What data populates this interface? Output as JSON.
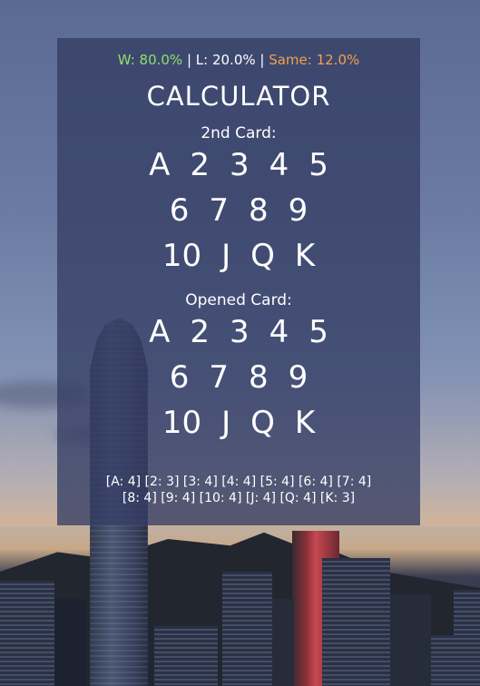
{
  "stats": {
    "win": "W: 80.0%",
    "sep1": " | ",
    "lose": "L: 20.0%",
    "sep2": " | ",
    "same": "Same: 12.0%"
  },
  "title": "CALCULATOR",
  "second_card": {
    "label": "2nd Card:",
    "rows": [
      [
        "A",
        "2",
        "3",
        "4",
        "5"
      ],
      [
        "6",
        "7",
        "8",
        "9"
      ],
      [
        "10",
        "J",
        "Q",
        "K"
      ]
    ]
  },
  "opened_card": {
    "label": "Opened Card:",
    "rows": [
      [
        "A",
        "2",
        "3",
        "4",
        "5"
      ],
      [
        "6",
        "7",
        "8",
        "9"
      ],
      [
        "10",
        "J",
        "Q",
        "K"
      ]
    ]
  },
  "counts": {
    "line1": "[A: 4] [2: 3] [3: 4] [4: 4] [5: 4] [6: 4] [7: 4]",
    "line2": "[8: 4] [9: 4] [10: 4] [J: 4] [Q: 4] [K: 3]"
  },
  "colors": {
    "win": "#8ee06a",
    "same": "#f5a04a",
    "panel": "#343e64"
  }
}
